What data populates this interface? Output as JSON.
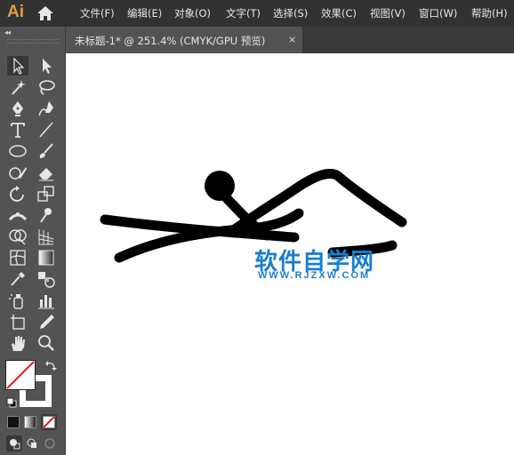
{
  "app": {
    "logo": "Ai",
    "accent": "#e69b3d"
  },
  "menu": {
    "items": [
      "文件(F)",
      "编辑(E)",
      "对象(O)",
      "文字(T)",
      "选择(S)",
      "效果(C)",
      "视图(V)",
      "窗口(W)",
      "帮助(H)"
    ]
  },
  "document": {
    "tab_title": "未标题-1* @ 251.4% (CMYK/GPU 预览)",
    "close_glyph": "×"
  },
  "toolbar": {
    "collapse_glyph": "◂◂",
    "tools": [
      "selection-tool",
      "direct-selection-tool",
      "magic-wand-tool",
      "lasso-tool",
      "pen-tool",
      "curvature-tool",
      "type-tool",
      "line-segment-tool",
      "ellipse-tool",
      "paintbrush-tool",
      "shaper-tool",
      "eraser-tool",
      "rotate-tool",
      "scale-tool",
      "width-tool",
      "puppet-warp-tool",
      "shape-builder-tool",
      "perspective-grid-tool",
      "mesh-tool",
      "gradient-tool",
      "eyedropper-tool",
      "blend-tool",
      "symbol-sprayer-tool",
      "column-graph-tool",
      "artboard-tool",
      "slice-tool",
      "hand-tool",
      "zoom-tool"
    ],
    "fill_color": "#ffffff",
    "stroke_color": "#000000"
  },
  "watermark": {
    "text": "软件自学网",
    "url": "WWW.RJZXW.COM",
    "color": "#1a7fd0"
  }
}
